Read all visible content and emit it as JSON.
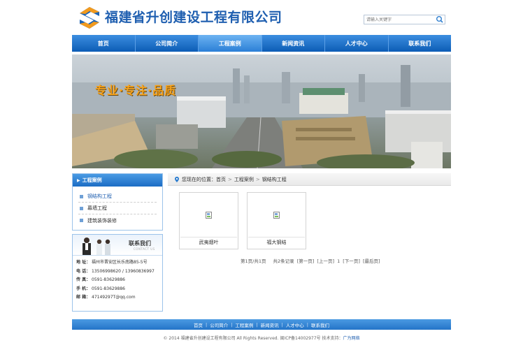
{
  "header": {
    "company_name": "福建省升创建设工程有限公司",
    "search_placeholder": "请输入关键字",
    "brand_color": "#1f5fb0"
  },
  "nav": {
    "items": [
      {
        "label": "首页",
        "active": false
      },
      {
        "label": "公司简介",
        "active": false
      },
      {
        "label": "工程案例",
        "active": true
      },
      {
        "label": "新闻资讯",
        "active": false
      },
      {
        "label": "人才中心",
        "active": false
      },
      {
        "label": "联系我们",
        "active": false
      }
    ]
  },
  "banner": {
    "slogan": "专业·专注·品质"
  },
  "sidebar": {
    "title": "工程案例",
    "categories": [
      {
        "label": "钢结构工程",
        "current": true
      },
      {
        "label": "幕墙工程",
        "current": false
      },
      {
        "label": "建筑装饰装修",
        "current": false
      }
    ],
    "contact": {
      "title": "联系我们",
      "subtitle": "CONTACT US",
      "lines": [
        {
          "label": "地 址：",
          "value": "福州市晋安区长乐南路85-5号"
        },
        {
          "label": "电 话：",
          "value": "13506998620 / 13960836997"
        },
        {
          "label": "传 真：",
          "value": "0591-83629886"
        },
        {
          "label": "手 机：",
          "value": "0591-83629886"
        },
        {
          "label": "邮 箱：",
          "value": "47149297T@qq.com"
        }
      ]
    }
  },
  "main": {
    "breadcrumb": {
      "prefix": "您现在的位置：",
      "items": [
        "首页",
        "工程案例",
        "钢结构工程"
      ]
    },
    "cases": [
      {
        "caption": "武夷烟叶"
      },
      {
        "caption": "福大钢结"
      }
    ],
    "pager": {
      "page_info": "第1页/共1页",
      "records": "共2条记录",
      "first": "[第一页]",
      "prev": "[上一页]",
      "current": "1",
      "next": "[下一页]",
      "last": "[最后页]"
    }
  },
  "footer": {
    "links": [
      "首页",
      "公司简介",
      "工程案例",
      "新闻资讯",
      "人才中心",
      "联系我们"
    ],
    "copyright": "© 2014 福建省升创建设工程有限公司 All Rights Reserved. 闽ICP备14002977号  技术支持：",
    "tech_support": "广为网络"
  }
}
